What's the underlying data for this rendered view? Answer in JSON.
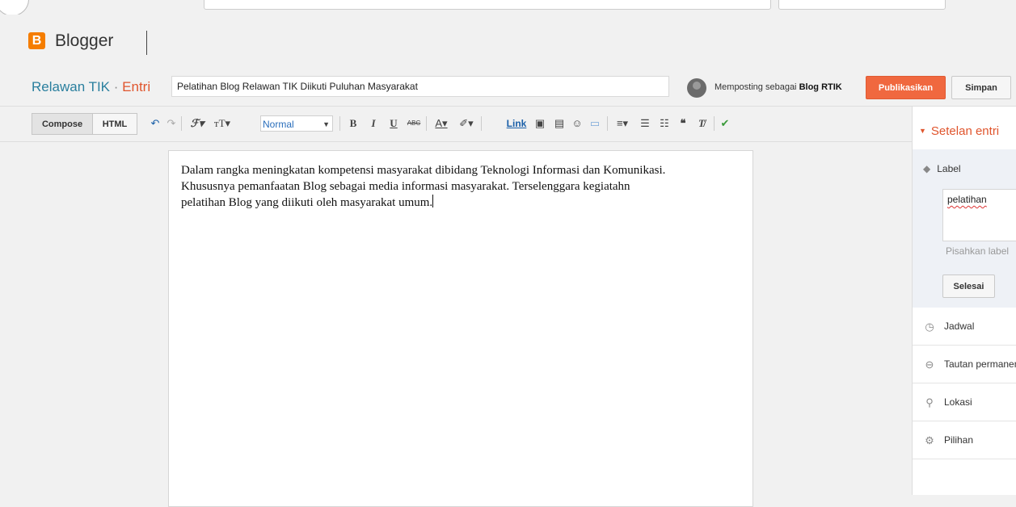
{
  "app": {
    "logo_letter": "B",
    "logo_text": "Blogger"
  },
  "post": {
    "blog_name": "Relawan TIK",
    "separator": "·",
    "section": "Entri",
    "title_value": "Pelatihan Blog Relawan TIK Diikuti Puluhan Masyarakat",
    "posting_as_prefix": "Memposting sebagai",
    "posting_as_name": "Blog RTIK",
    "publish_label": "Publikasikan",
    "save_label": "Simpan"
  },
  "toolbar": {
    "compose_label": "Compose",
    "html_label": "HTML",
    "format_value": "Normal",
    "link_label": "Link",
    "buttons": [
      "undo-icon",
      "redo-icon",
      "font-family-icon",
      "font-size-icon",
      "bold-icon",
      "italic-icon",
      "underline-icon",
      "strikethrough-icon",
      "text-color-icon",
      "highlight-icon",
      "image-icon",
      "video-icon",
      "emoji-icon",
      "jump-break-icon",
      "align-icon",
      "numbered-list-icon",
      "bullet-list-icon",
      "quote-icon",
      "clear-format-icon",
      "spellcheck-icon"
    ]
  },
  "editor": {
    "line1": "Dalam rangka meningkatan kompetensi masyarakat dibidang Teknologi Informasi dan Komunikasi.",
    "line2": "Khususnya pemanfaatan Blog sebagai media informasi masyarakat. Terselenggara kegiatahn",
    "line3": "pelatihan Blog yang diikuti oleh masyarakat umum."
  },
  "sidebar": {
    "header": "Setelan entri",
    "label_section": "Label",
    "label_value": "pelatihan",
    "label_hint": "Pisahkan label",
    "done_label": "Selesai",
    "items": [
      {
        "label": "Jadwal",
        "icon": "clock-icon"
      },
      {
        "label": "Tautan permanen",
        "icon": "link-icon"
      },
      {
        "label": "Lokasi",
        "icon": "location-icon"
      },
      {
        "label": "Pilihan",
        "icon": "gear-icon"
      }
    ]
  },
  "colors": {
    "accent": "#e0552d",
    "blog_name": "#2a7f9e",
    "publish": "#f0683f"
  }
}
